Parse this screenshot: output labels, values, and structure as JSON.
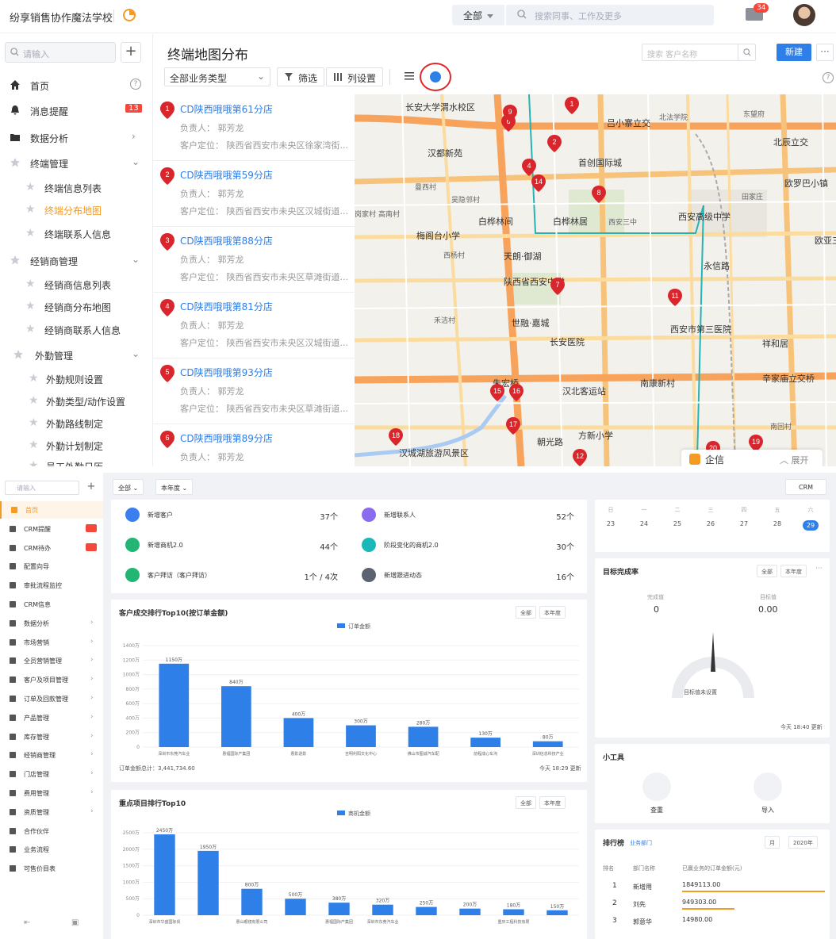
{
  "top": {
    "brand": "纷享销售协作魔法学校",
    "scope": "全部",
    "search_placeholder": "搜索同事、工作及更多",
    "mail_badge": "34",
    "sidebar": {
      "search_placeholder": "请输入",
      "items": [
        {
          "label": "首页",
          "icon": "home-icon"
        },
        {
          "label": "消息提醒",
          "icon": "bell-icon",
          "badge": "13"
        },
        {
          "label": "数据分析",
          "icon": "folder-icon"
        },
        {
          "label": "终端管理",
          "icon": "star-icon"
        },
        {
          "label": "经销商管理",
          "icon": "star-icon"
        },
        {
          "label": "外勤管理",
          "icon": "star-icon"
        }
      ],
      "terminal_sub": [
        "终端信息列表",
        "终端分布地图",
        "终端联系人信息"
      ],
      "dealer_sub": [
        "经销商信息列表",
        "经销商分布地图",
        "经销商联系人信息"
      ],
      "field_sub": [
        "外勤规则设置",
        "外勤类型/动作设置",
        "外勤路线制定",
        "外勤计划制定",
        "员工外勤日历"
      ]
    },
    "page_title": "终端地图分布",
    "customer_search_placeholder": "搜索 客户名称",
    "new_label": "新建",
    "more_label": "···",
    "biz_type": "全部业务类型",
    "filter_label": "筛选",
    "columns_label": "列设置",
    "stores": [
      {
        "num": "1",
        "name": "CD陕西哦哦第61分店",
        "owner": "负责人：  郭芳龙",
        "loc": "客户定位：  陕西省西安市未央区徐家湾街..."
      },
      {
        "num": "2",
        "name": "CD陕西哦哦第59分店",
        "owner": "负责人：  郭芳龙",
        "loc": "客户定位：  陕西省西安市未央区汉城街道..."
      },
      {
        "num": "3",
        "name": "CD陕西哦哦第88分店",
        "owner": "负责人：  郭芳龙",
        "loc": "客户定位：  陕西省西安市未央区草滩街道..."
      },
      {
        "num": "4",
        "name": "CD陕西哦哦第81分店",
        "owner": "负责人：  郭芳龙",
        "loc": "客户定位：  陕西省西安市未央区汉城街道..."
      },
      {
        "num": "5",
        "name": "CD陕西哦哦第93分店",
        "owner": "负责人：  郭芳龙",
        "loc": "客户定位：  陕西省西安市未央区草滩街道..."
      },
      {
        "num": "6",
        "name": "CD陕西哦哦第89分店",
        "owner": "负责人：  郭芳龙",
        "loc": ""
      }
    ],
    "map": {
      "places": [
        "长安大学渭水校区",
        "吕小寨立交",
        "北辰立交",
        "汉都新苑",
        "首创国际城",
        "欧罗巴小镇",
        "西安高级中学",
        "白桦林间",
        "白桦林居",
        "梅阁台小学",
        "天朗·御湖",
        "永信路",
        "陕西省西安中学",
        "世融·嘉城",
        "长安医院",
        "西安市第三医院",
        "祥和居",
        "朱宏桥",
        "汉北客运站",
        "南康新村",
        "辛家庙立交桥",
        "方新小学",
        "汉城湖旅游风景区",
        "欧亚三",
        "朝光路"
      ],
      "minor": [
        "北法学院",
        "曼西村",
        "吴隐邻村",
        "高南村",
        "西杨村",
        "田家庄",
        "岗家村",
        "禾洁村",
        "南回村",
        "东望府",
        "西安三中"
      ],
      "pins": [
        "1",
        "2",
        "4",
        "6",
        "7",
        "8",
        "9",
        "11",
        "12",
        "14",
        "15",
        "16",
        "17",
        "18",
        "19",
        "20"
      ]
    },
    "qixin": {
      "label": "企信",
      "expand": "展开"
    }
  },
  "bottom": {
    "sidebar_search": "请输入",
    "nav": [
      "首页",
      "CRM提醒",
      "CRM待办",
      "配置向导",
      "审批流程监控",
      "CRM信息",
      "数据分析",
      "市场营销",
      "全员营销管理",
      "客户及项目管理",
      "订单及回款管理",
      "产品管理",
      "库存管理",
      "经销商管理",
      "门店管理",
      "费用管理",
      "资质管理",
      "合作伙伴",
      "业务流程",
      "可售价目表"
    ],
    "filter_all": "全部",
    "filter_year": "本年度",
    "crm_label": "CRM",
    "stats": [
      {
        "label": "新增客户",
        "value": "37个",
        "color": "#3a7ff0"
      },
      {
        "label": "新增联系人",
        "value": "52个",
        "color": "#8a6cf0"
      },
      {
        "label": "新增商机2.0",
        "value": "44个",
        "color": "#22b573"
      },
      {
        "label": "阶段变化的商机2.0",
        "value": "30个",
        "color": "#1ab8b8"
      },
      {
        "label": "客户拜访（客户拜访）",
        "value": "1个 / 4次",
        "color": "#22b573"
      },
      {
        "label": "新增跟进动态",
        "value": "16个",
        "color": "#5c6370"
      }
    ],
    "calendar": {
      "week": [
        "日",
        "一",
        "二",
        "三",
        "四",
        "五",
        "六"
      ],
      "days": [
        "23",
        "24",
        "25",
        "26",
        "27",
        "28",
        "29"
      ],
      "selected": "29"
    },
    "goal": {
      "title": "目标完成率",
      "left_label": "完成值",
      "left_value": "0",
      "right_label": "目标值",
      "right_value": "0.00",
      "gauge_label": "目标值未设置",
      "time": "今天 18:40 更新",
      "chip1": "全部",
      "chip2": "本年度"
    },
    "tools": {
      "title": "小工具",
      "items": [
        "查重",
        "导入"
      ]
    },
    "rank": {
      "title": "排行榜",
      "sub": "业务部门",
      "month": "月",
      "year": "2020年",
      "cols": [
        "排名",
        "部门名称",
        "已赢业务的订单金额(元)"
      ],
      "rows": [
        {
          "r": "1",
          "name": "新增用",
          "val": "1849113.00"
        },
        {
          "r": "2",
          "name": "刘先",
          "val": "949303.00"
        },
        {
          "r": "3",
          "name": "郭意华",
          "val": "14980.00"
        }
      ]
    },
    "chart1": {
      "title": "客户成交排行Top10(按订单金额)",
      "chip1": "全部",
      "chip2": "本年度",
      "legend": "订单金额",
      "footer_left": "订单金额总计：3,441,734.60",
      "footer_right": "今天 18:29 更新",
      "yticks": [
        "0",
        "200万",
        "400万",
        "600万",
        "800万",
        "1000万",
        "1200万",
        "1400万"
      ]
    },
    "chart2": {
      "title": "重点项目排行Top10",
      "chip1": "全部",
      "chip2": "本年度",
      "legend": "商机金额",
      "yticks": [
        "0",
        "500万",
        "1000万",
        "1500万",
        "2000万",
        "2500万"
      ]
    }
  },
  "chart_data": [
    {
      "type": "bar",
      "title": "客户成交排行Top10(按订单金额)",
      "legend": [
        "订单金额"
      ],
      "categories": [
        "深圳市东莞汽车业务有限公司",
        "惠福国际产集团",
        "惠影逊影",
        "吉明利阳文化中心",
        "佛山市图诚汽车配套业务有限公司",
        "前程成心车沟",
        "深圳信息科技产业有限公司"
      ],
      "values": [
        1150,
        840,
        400,
        300,
        280,
        130,
        80
      ],
      "ylim": [
        0,
        1400
      ],
      "yunit": "万"
    },
    {
      "type": "bar",
      "title": "重点项目排行Top10",
      "legend": [
        "商机金额"
      ],
      "categories": [
        "深圳市华盛国际贸易有限公司",
        "",
        "惠山眼镜有限公司",
        "",
        "惠福国际产集团",
        "深圳市东莞汽车业务有限公司",
        "",
        "",
        "重庆工程科技有限公司",
        ""
      ],
      "values": [
        2450,
        1950,
        800,
        500,
        380,
        320,
        250,
        200,
        180,
        150
      ],
      "ylim": [
        0,
        2500
      ],
      "yunit": "万"
    }
  ]
}
